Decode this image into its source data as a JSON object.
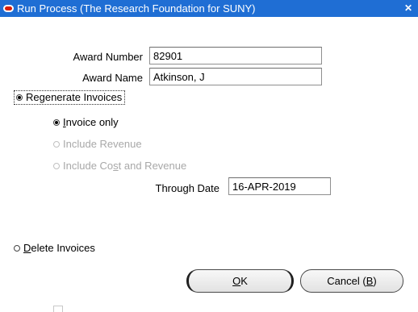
{
  "window": {
    "title": "Run Process (The Research Foundation for SUNY)",
    "close_glyph": "✕",
    "icon": "oracle-icon"
  },
  "fields": {
    "award_number": {
      "label": "Award Number",
      "value": "82901"
    },
    "award_name": {
      "label": "Award Name",
      "value": "Atkinson, J"
    },
    "through_date": {
      "label": "Through Date",
      "value": "16-APR-2019"
    }
  },
  "options": {
    "regenerate": {
      "label": "Regenerate Invoices",
      "selected": true
    },
    "invoice_only": {
      "label_pre": "",
      "label_ul": "I",
      "label_post": "nvoice only",
      "selected": true
    },
    "include_revenue": {
      "label": "Include Revenue",
      "disabled": true
    },
    "include_cost_revenue": {
      "label_pre": "Include Co",
      "label_ul": "s",
      "label_post": "t and Revenue",
      "disabled": true
    },
    "delete": {
      "label_pre": "",
      "label_ul": "D",
      "label_post": "elete Invoices",
      "selected": false
    }
  },
  "buttons": {
    "ok": {
      "label_ul": "O",
      "label_post": "K"
    },
    "cancel": {
      "label_pre": "Cancel (",
      "label_ul": "B",
      "label_post": ")"
    }
  }
}
